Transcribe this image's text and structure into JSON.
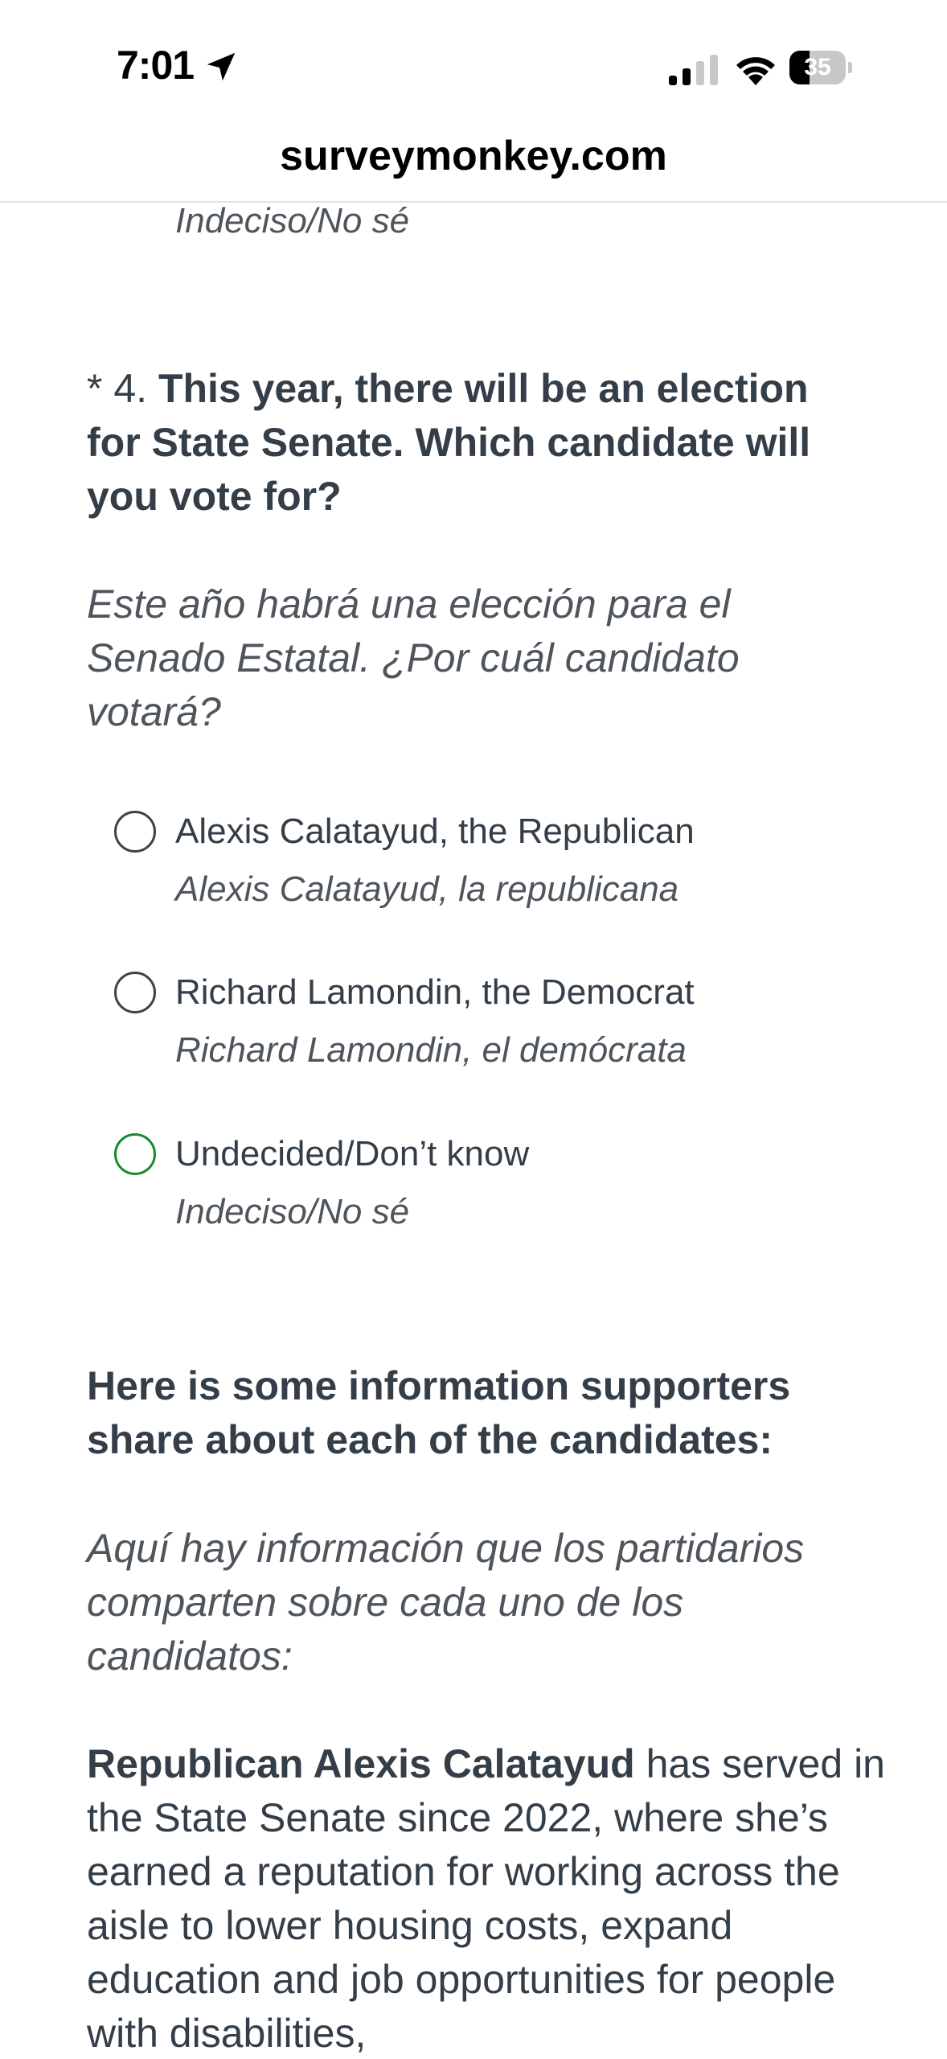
{
  "status_bar": {
    "time": "7:01",
    "battery_level": "35",
    "battery_fraction": 0.35,
    "icons": [
      "location-arrow-icon",
      "cellular-signal-icon",
      "wifi-icon",
      "battery-icon"
    ]
  },
  "browser": {
    "url": "surveymonkey.com"
  },
  "previous_question": {
    "last_option_es": "Indeciso/No sé"
  },
  "question": {
    "prefix": "* 4. ",
    "text": "This year, there will be an election for State Senate. Which candidate will you vote for?",
    "text_es": "Este año habrá una elección para el Senado Estatal. ¿Por cuál candidato votará?",
    "options": [
      {
        "label": "Alexis Calatayud, the Republican",
        "label_es": "Alexis Calatayud, la republicana",
        "selected": false
      },
      {
        "label": "Richard Lamondin, the Democrat",
        "label_es": "Richard Lamondin, el demócrata",
        "selected": false
      },
      {
        "label": "Undecided/Don’t know",
        "label_es": "Indeciso/No sé",
        "selected": false,
        "focused": true
      }
    ]
  },
  "info": {
    "heading": "Here is some information supporters share about each of the candidates:",
    "heading_es": "Aquí hay información que los partidarios comparten sobre cada uno de los candidatos:",
    "bio_name": "Republican Alexis Calatayud",
    "bio_text": " has served in the State Senate since 2022, where she’s earned a reputation for working across the aisle to lower housing costs, expand education and job opportunities for people with disabilities,"
  },
  "colors": {
    "text_primary": "#333e48",
    "text_secondary": "#4f555c",
    "focus_green": "#168a2e",
    "divider": "#e2e2e2"
  }
}
